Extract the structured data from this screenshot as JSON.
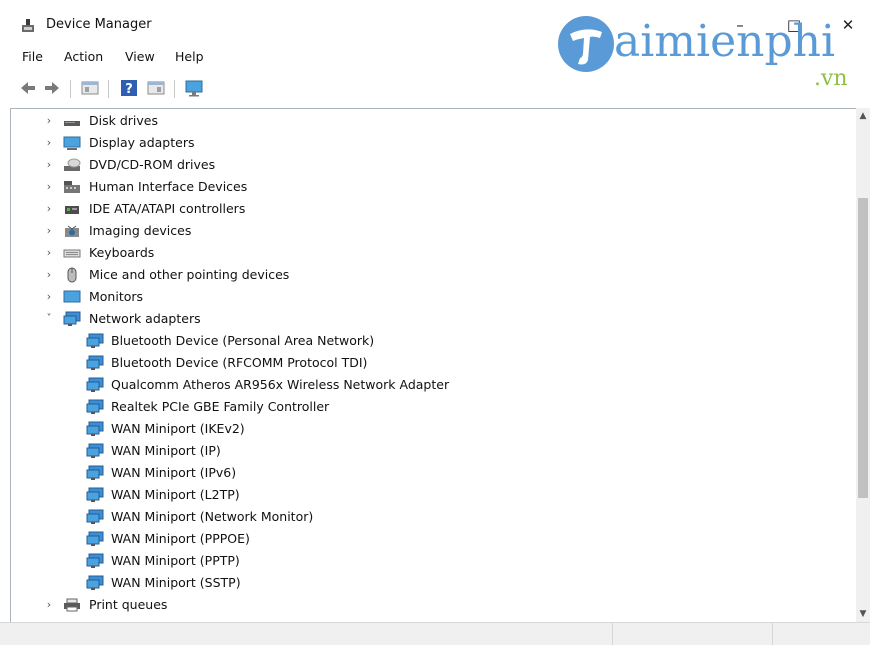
{
  "window": {
    "title": "Device Manager",
    "minimize_glyph": "–",
    "maximize_glyph": "□",
    "close_glyph": "✕"
  },
  "watermark": {
    "main": "aimienphi",
    "suffix": ".vn",
    "logo_color": "#5a9ad6",
    "suffix_color": "#8fbf45"
  },
  "menu": {
    "items": [
      "File",
      "Action",
      "View",
      "Help"
    ]
  },
  "toolbar": {
    "buttons": [
      "back-icon",
      "forward-icon",
      "properties-icon",
      "help-icon",
      "show-hidden-icon",
      "monitor-icon"
    ]
  },
  "tree": {
    "categories": [
      {
        "label": "Disk drives",
        "icon": "disk-drive-icon",
        "state": "collapsed"
      },
      {
        "label": "Display adapters",
        "icon": "display-adapter-icon",
        "state": "collapsed"
      },
      {
        "label": "DVD/CD-ROM drives",
        "icon": "dvd-drive-icon",
        "state": "collapsed"
      },
      {
        "label": "Human Interface Devices",
        "icon": "hid-icon",
        "state": "collapsed"
      },
      {
        "label": "IDE ATA/ATAPI controllers",
        "icon": "ide-controller-icon",
        "state": "collapsed"
      },
      {
        "label": "Imaging devices",
        "icon": "imaging-device-icon",
        "state": "collapsed"
      },
      {
        "label": "Keyboards",
        "icon": "keyboard-icon",
        "state": "collapsed"
      },
      {
        "label": "Mice and other pointing devices",
        "icon": "mouse-icon",
        "state": "collapsed"
      },
      {
        "label": "Monitors",
        "icon": "monitor-icon",
        "state": "collapsed"
      },
      {
        "label": "Network adapters",
        "icon": "network-adapter-icon",
        "state": "expanded"
      }
    ],
    "network_adapters": [
      "Bluetooth Device (Personal Area Network)",
      "Bluetooth Device (RFCOMM Protocol TDI)",
      "Qualcomm Atheros AR956x Wireless Network Adapter",
      "Realtek PCIe GBE Family Controller",
      "WAN Miniport (IKEv2)",
      "WAN Miniport (IP)",
      "WAN Miniport (IPv6)",
      "WAN Miniport (L2TP)",
      "WAN Miniport (Network Monitor)",
      "WAN Miniport (PPPOE)",
      "WAN Miniport (PPTP)",
      "WAN Miniport (SSTP)"
    ],
    "after": [
      {
        "label": "Print queues",
        "icon": "printer-icon",
        "state": "collapsed"
      }
    ]
  },
  "colors": {
    "network_icon": "#3c8fd6",
    "monitor_icon": "#4aa3df"
  }
}
